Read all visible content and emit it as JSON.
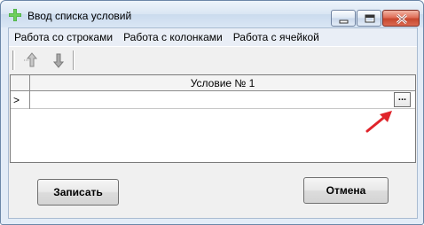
{
  "window": {
    "title": "Ввод списка условий",
    "icon": "green-plus-icon"
  },
  "menu": {
    "items": [
      "Работа со строками",
      "Работа с колонками",
      "Работа с ячейкой"
    ]
  },
  "toolbar": {
    "move_up_icon": "arrow-up-icon",
    "move_down_icon": "arrow-down-icon"
  },
  "grid": {
    "columns": [
      "Условие № 1"
    ],
    "row_indicator": ">",
    "cell_value": "",
    "ellipsis_label": "..."
  },
  "buttons": {
    "save_label": "Записать",
    "cancel_label": "Отмена"
  },
  "colors": {
    "annotation_arrow": "#e0242b",
    "icon_green": "#3aa33a"
  }
}
